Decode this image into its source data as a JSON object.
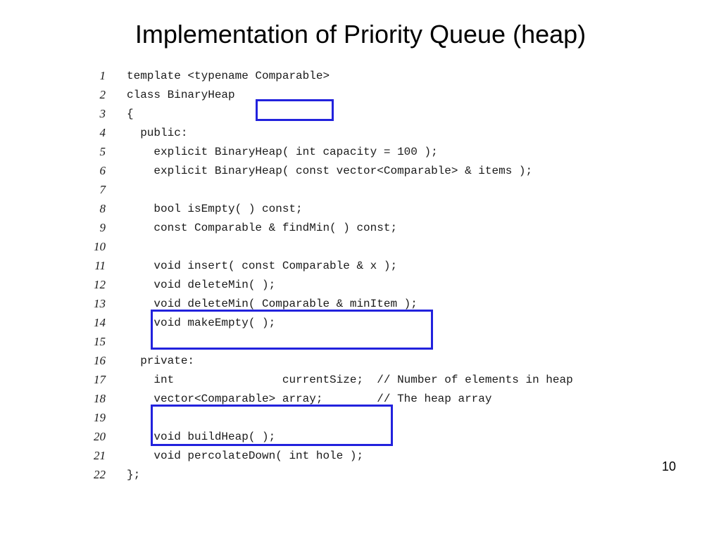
{
  "title": "Implementation of Priority Queue (heap)",
  "pageNumber": "10",
  "code": {
    "lines": [
      {
        "n": "1",
        "t": "template <typename Comparable>"
      },
      {
        "n": "2",
        "t": "class BinaryHeap"
      },
      {
        "n": "3",
        "t": "{"
      },
      {
        "n": "4",
        "t": "  public:"
      },
      {
        "n": "5",
        "t": "    explicit BinaryHeap( int capacity = 100 );"
      },
      {
        "n": "6",
        "t": "    explicit BinaryHeap( const vector<Comparable> & items );"
      },
      {
        "n": "7",
        "t": ""
      },
      {
        "n": "8",
        "t": "    bool isEmpty( ) const;"
      },
      {
        "n": "9",
        "t": "    const Comparable & findMin( ) const;"
      },
      {
        "n": "10",
        "t": ""
      },
      {
        "n": "11",
        "t": "    void insert( const Comparable & x );"
      },
      {
        "n": "12",
        "t": "    void deleteMin( );"
      },
      {
        "n": "13",
        "t": "    void deleteMin( Comparable & minItem );"
      },
      {
        "n": "14",
        "t": "    void makeEmpty( );"
      },
      {
        "n": "15",
        "t": ""
      },
      {
        "n": "16",
        "t": "  private:"
      },
      {
        "n": "17",
        "t": "    int                currentSize;  // Number of elements in heap"
      },
      {
        "n": "18",
        "t": "    vector<Comparable> array;        // The heap array"
      },
      {
        "n": "19",
        "t": ""
      },
      {
        "n": "20",
        "t": "    void buildHeap( );"
      },
      {
        "n": "21",
        "t": "    void percolateDown( int hole );"
      },
      {
        "n": "22",
        "t": "};"
      }
    ]
  }
}
